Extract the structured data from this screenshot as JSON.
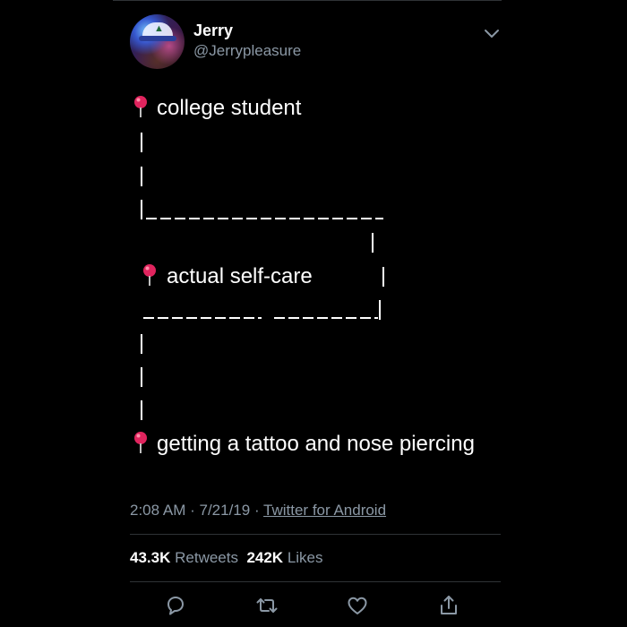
{
  "user": {
    "display_name": "Jerry",
    "handle": "@Jerrypleasure"
  },
  "tweet": {
    "line1": "college student",
    "line2": "actual self-care",
    "line3": "getting a tattoo and nose piercing",
    "pin_icon": "round-pushpin-icon"
  },
  "meta": {
    "time": "2:08 AM",
    "sep1": " · ",
    "date": "7/21/19",
    "sep2": " · ",
    "source": "Twitter for Android"
  },
  "stats": {
    "retweets_count": "43.3K",
    "retweets_label": "Retweets",
    "likes_count": "242K",
    "likes_label": "Likes"
  },
  "actions": [
    "reply-icon",
    "retweet-icon",
    "like-icon",
    "share-icon"
  ],
  "colors": {
    "background": "#000000",
    "text": "#ffffff",
    "muted": "#8b98a5",
    "divider": "#2f3336",
    "pin": "#e0245e"
  }
}
